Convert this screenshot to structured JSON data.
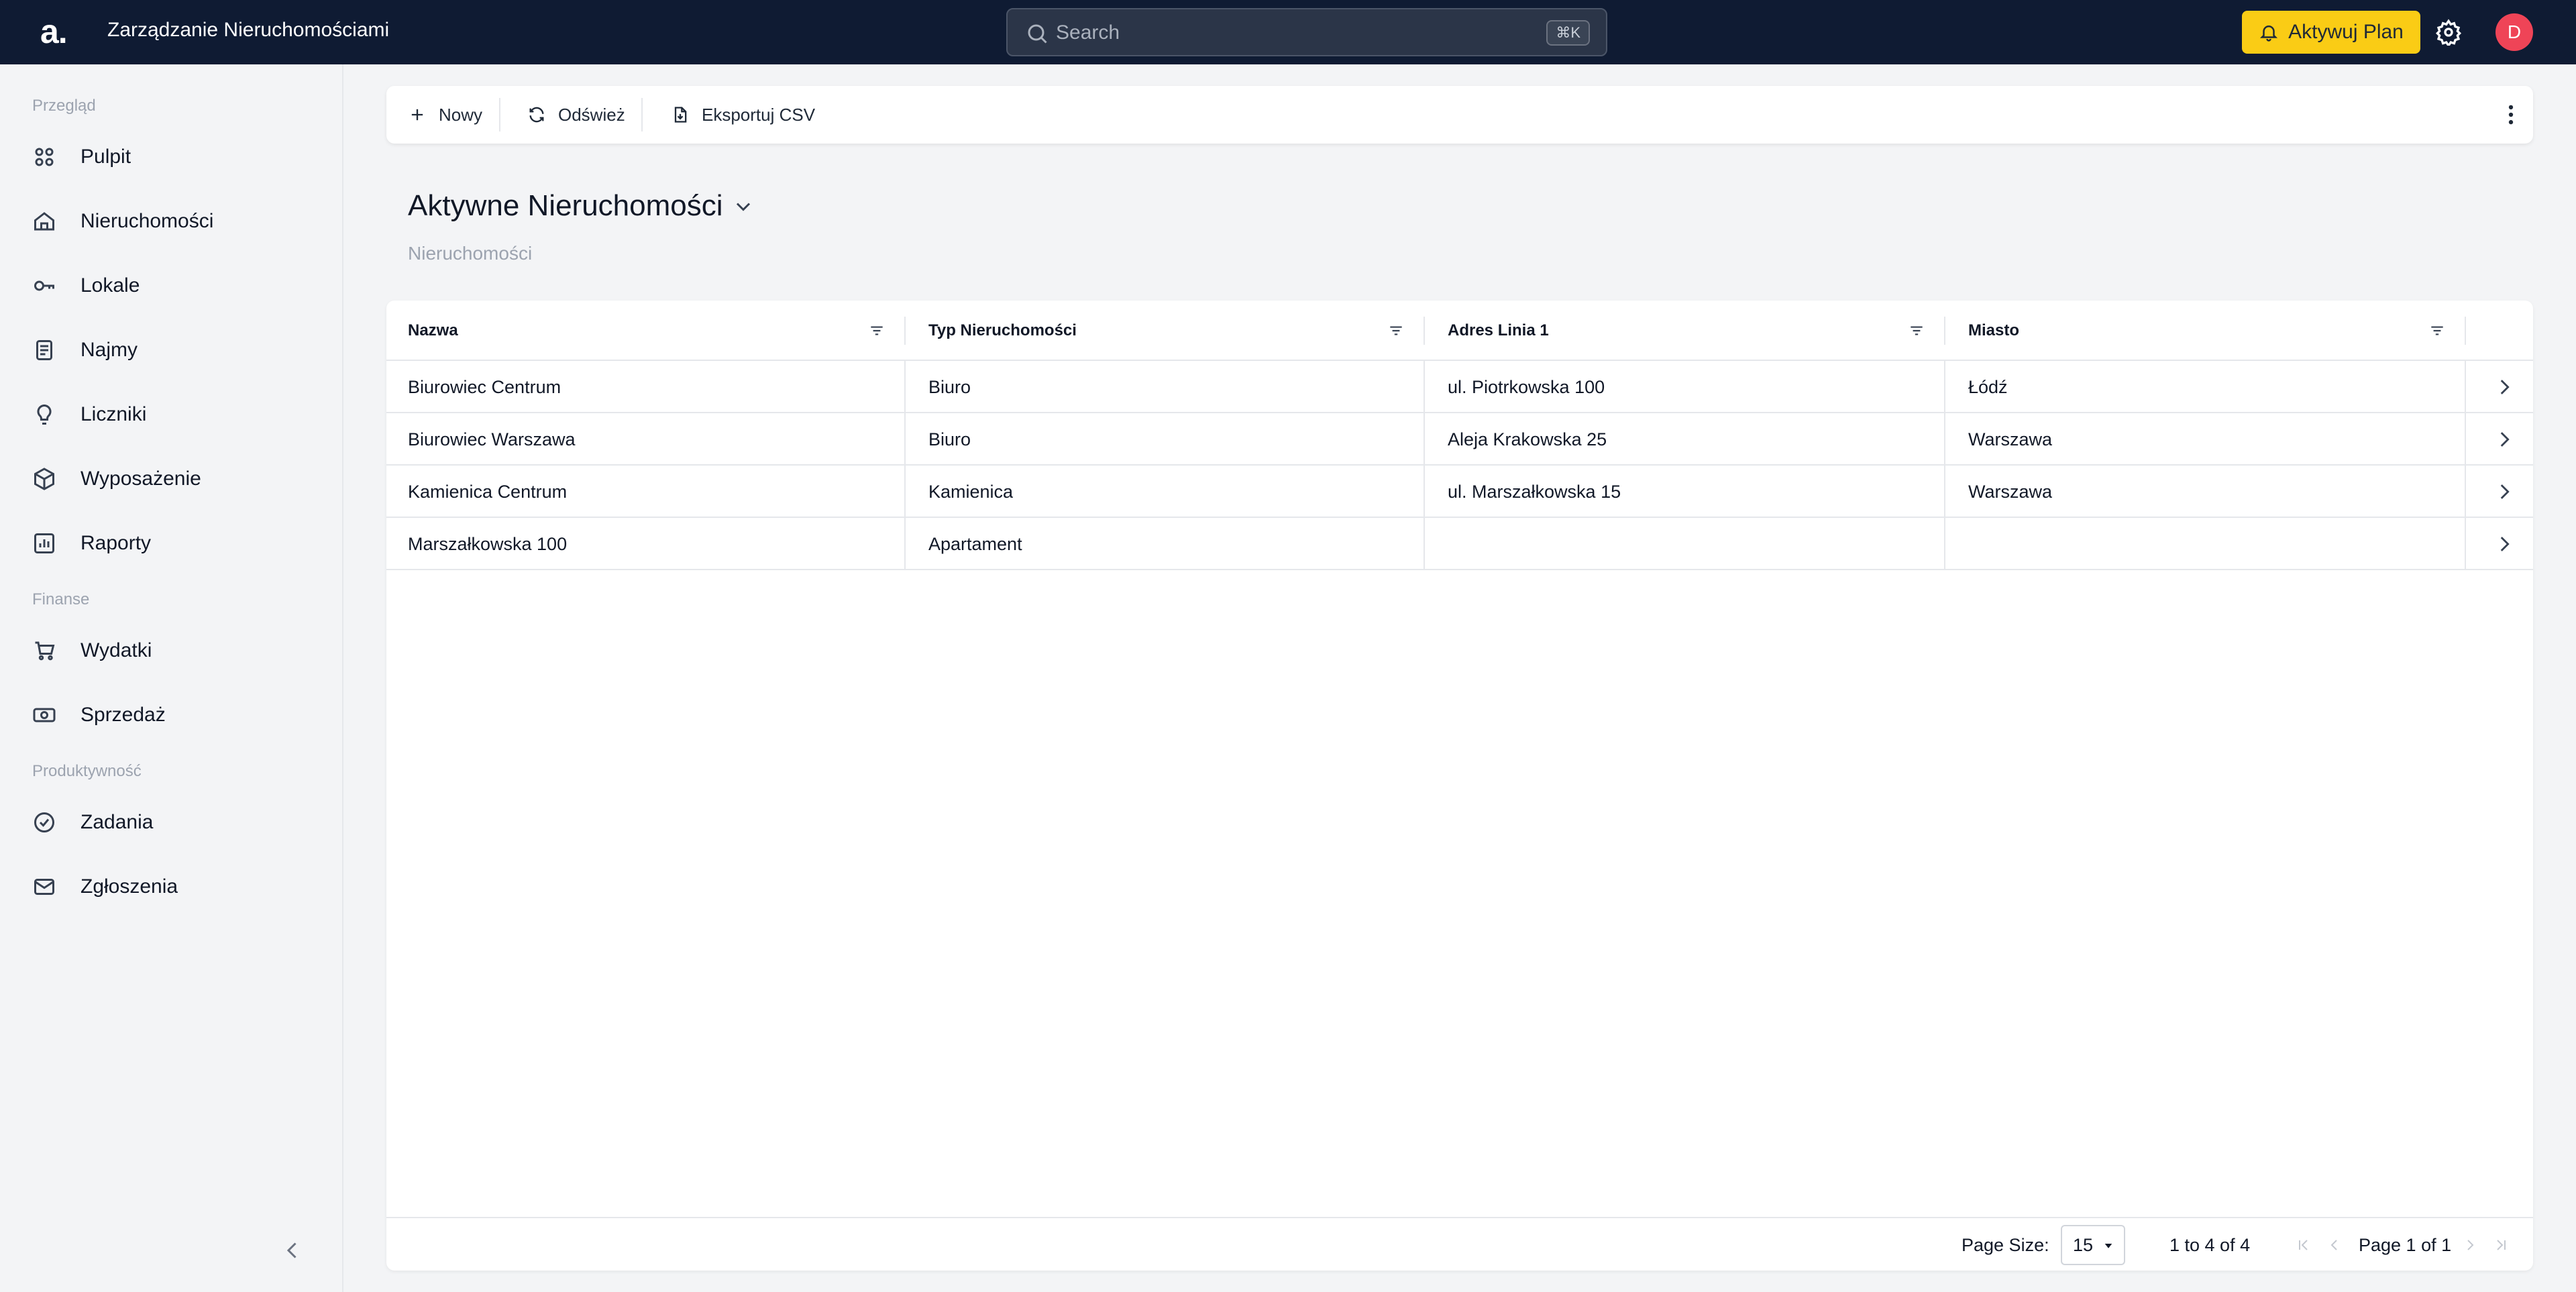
{
  "header": {
    "logo": "a.",
    "title": "Zarządzanie Nieruchomościami",
    "search_placeholder": "Search",
    "search_shortcut": "⌘K",
    "activate_label": "Aktywuj Plan",
    "avatar_initial": "D"
  },
  "sidebar": {
    "sections": [
      {
        "label": "Przegląd"
      },
      {
        "label": "Finanse"
      },
      {
        "label": "Produktywność"
      }
    ],
    "items": [
      {
        "label": "Pulpit",
        "icon": "dashboard-icon"
      },
      {
        "label": "Nieruchomości",
        "icon": "home-icon"
      },
      {
        "label": "Lokale",
        "icon": "key-icon"
      },
      {
        "label": "Najmy",
        "icon": "document-icon"
      },
      {
        "label": "Liczniki",
        "icon": "bulb-icon"
      },
      {
        "label": "Wyposażenie",
        "icon": "box-icon"
      },
      {
        "label": "Raporty",
        "icon": "report-icon"
      },
      {
        "label": "Wydatki",
        "icon": "cart-icon"
      },
      {
        "label": "Sprzedaż",
        "icon": "cash-icon"
      },
      {
        "label": "Zadania",
        "icon": "check-circle-icon"
      },
      {
        "label": "Zgłoszenia",
        "icon": "mail-icon"
      }
    ]
  },
  "toolbar": {
    "new_label": "Nowy",
    "refresh_label": "Odśwież",
    "export_label": "Eksportuj CSV"
  },
  "page": {
    "title": "Aktywne Nieruchomości",
    "subtitle": "Nieruchomości"
  },
  "table": {
    "columns": [
      "Nazwa",
      "Typ Nieruchomości",
      "Adres Linia 1",
      "Miasto"
    ],
    "rows": [
      [
        "Biurowiec Centrum",
        "Biuro",
        "ul. Piotrkowska 100",
        "Łódź"
      ],
      [
        "Biurowiec Warszawa",
        "Biuro",
        "Aleja Krakowska 25",
        "Warszawa"
      ],
      [
        "Kamienica Centrum",
        "Kamienica",
        "ul. Marszałkowska 15",
        "Warszawa"
      ],
      [
        "Marszałkowska 100",
        "Apartament",
        "",
        ""
      ]
    ]
  },
  "pagination": {
    "page_size_label": "Page Size:",
    "page_size_value": "15",
    "range_text": "1 to 4 of 4",
    "page_text": "Page 1 of 1"
  },
  "colors": {
    "topbar": "#0f1b33",
    "accent": "#facc15",
    "avatar": "#ef4457"
  }
}
